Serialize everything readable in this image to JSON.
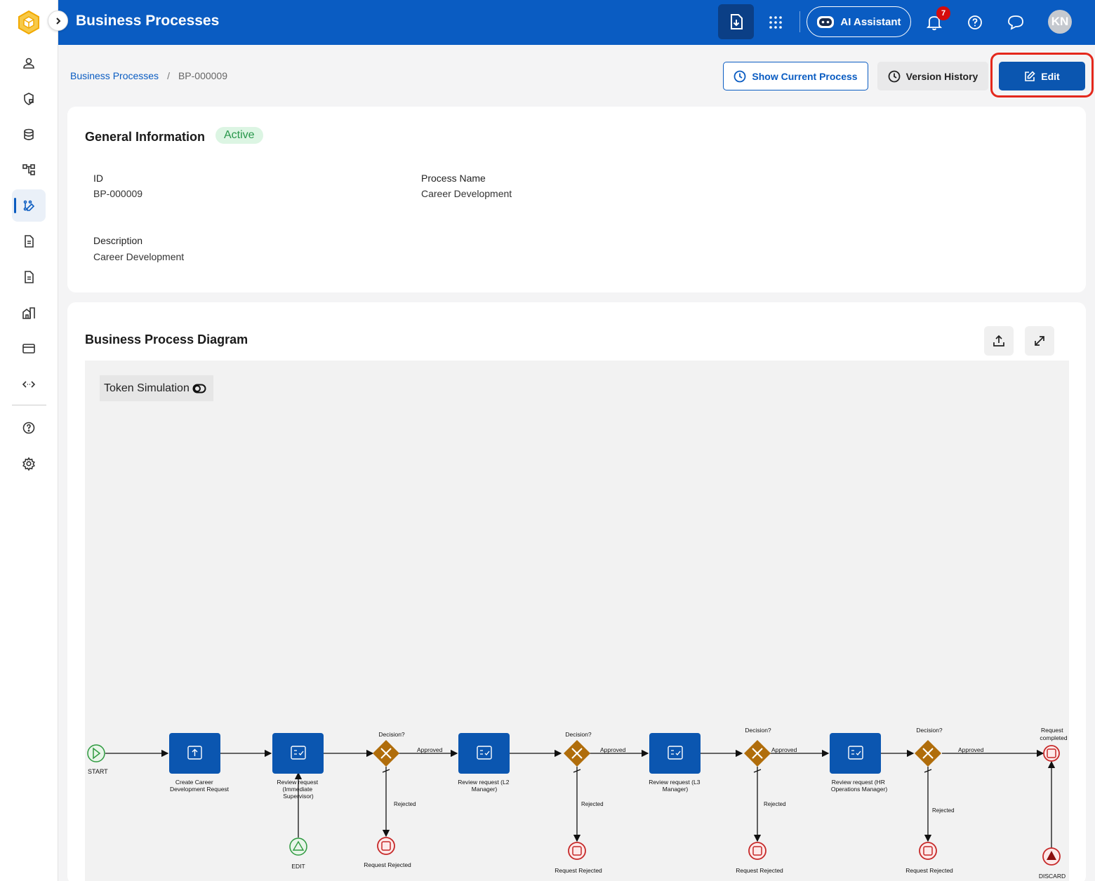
{
  "header": {
    "title": "Business Processes",
    "ai_label": "AI Assistant",
    "notification_count": "7",
    "avatar_initials": "KN"
  },
  "breadcrumb": {
    "root": "Business Processes",
    "separator": "/",
    "current": "BP-000009"
  },
  "actions": {
    "show_current": "Show Current Process",
    "version_history": "Version History",
    "edit": "Edit"
  },
  "general": {
    "title": "General Information",
    "status": "Active",
    "id_label": "ID",
    "id_value": "BP-000009",
    "name_label": "Process Name",
    "name_value": "Career Development",
    "desc_label": "Description",
    "desc_value": "Career Development"
  },
  "diagram": {
    "title": "Business Process Diagram",
    "token_simulation": "Token Simulation",
    "start_label": "START",
    "edit_label": "EDIT",
    "discard_label": "DISCARD",
    "completed_label": [
      "Request",
      "completed"
    ],
    "tasks": [
      [
        "Create Career",
        "Development Request"
      ],
      [
        "Review request",
        "(Immediate",
        "Supervisor)"
      ],
      [
        "Review request (L2",
        "Manager)"
      ],
      [
        "Review request (L3",
        "Manager)"
      ],
      [
        "Review request (HR",
        "Operations Manager)"
      ]
    ],
    "gateway_label": "Decision?",
    "approved_label": "Approved",
    "rejected_label": "Rejected",
    "reject_end_label": "Request Rejected"
  },
  "colors": {
    "brand": "#0a5cc2",
    "task": "#0b56b0",
    "gateway": "#b06d0b",
    "start": "#2e9a3f",
    "end": "#c62828",
    "active_bg": "#dcf5e3",
    "active_text": "#27964a",
    "highlight": "#e4281c"
  }
}
